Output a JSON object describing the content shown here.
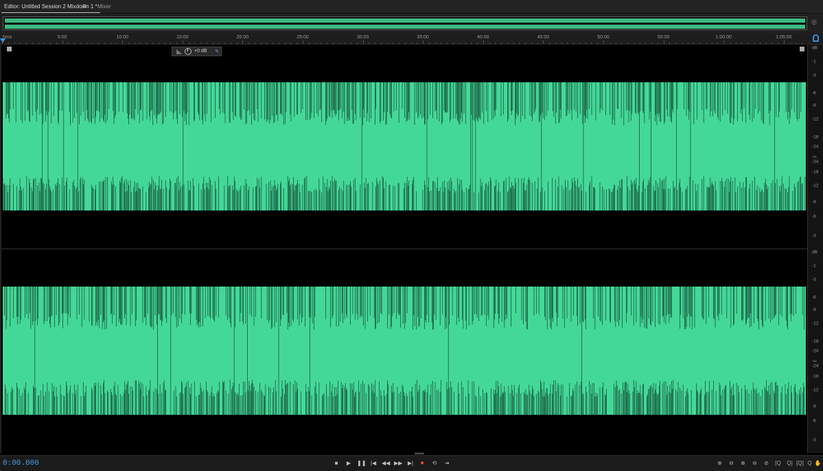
{
  "tabs": [
    {
      "label": "Editor: Untitled Session 2 Mixdown 1 *",
      "active": true
    },
    {
      "label": "Mixer",
      "active": false
    }
  ],
  "ruler": {
    "unit": "hms",
    "labels": [
      "5:00",
      "10:00",
      "15:00",
      "20:00",
      "25:00",
      "30:00",
      "35:00",
      "40:00",
      "45:00",
      "50:00",
      "55:00",
      "1:00:00",
      "1:05:00"
    ]
  },
  "hud": {
    "value": "+0 dB"
  },
  "db_scale": {
    "unit": "dB",
    "channel_labels": [
      "-1",
      "-3",
      "-6",
      "-9",
      "-12",
      "-18",
      "-24",
      "-∞",
      "-24",
      "-18",
      "-12",
      "-9",
      "-6",
      "-3"
    ]
  },
  "colors": {
    "waveform": "#44d898",
    "timecode": "#4a9ee6",
    "record": "#e04a3c"
  },
  "transport": {
    "timecode": "0:00.000",
    "buttons": [
      {
        "name": "stop-button",
        "glyph": "■"
      },
      {
        "name": "play-button",
        "glyph": "▶"
      },
      {
        "name": "pause-button",
        "glyph": "❚❚"
      },
      {
        "name": "go-to-start-button",
        "glyph": "|◀"
      },
      {
        "name": "rewind-button",
        "glyph": "◀◀"
      },
      {
        "name": "fast-forward-button",
        "glyph": "▶▶"
      },
      {
        "name": "go-to-end-button",
        "glyph": "▶|"
      },
      {
        "name": "record-button",
        "glyph": "●"
      },
      {
        "name": "loop-button",
        "glyph": "⟲"
      },
      {
        "name": "skip-selection-button",
        "glyph": "⇥"
      }
    ],
    "zoom_buttons": [
      {
        "name": "zoom-in-amplitude-button",
        "glyph": "⊕"
      },
      {
        "name": "zoom-out-amplitude-button",
        "glyph": "⊖"
      },
      {
        "name": "zoom-in-time-button",
        "glyph": "⊕"
      },
      {
        "name": "zoom-out-time-button",
        "glyph": "⊖"
      },
      {
        "name": "zoom-out-full-button",
        "glyph": "⊘"
      },
      {
        "name": "zoom-in-point-button",
        "glyph": "[Q"
      },
      {
        "name": "zoom-in-out-point-button",
        "glyph": "Q]"
      },
      {
        "name": "zoom-selection-button",
        "glyph": "[Q]"
      },
      {
        "name": "zoom-left-button",
        "glyph": "Q"
      },
      {
        "name": "hand-tool-button",
        "glyph": "✋"
      }
    ]
  }
}
